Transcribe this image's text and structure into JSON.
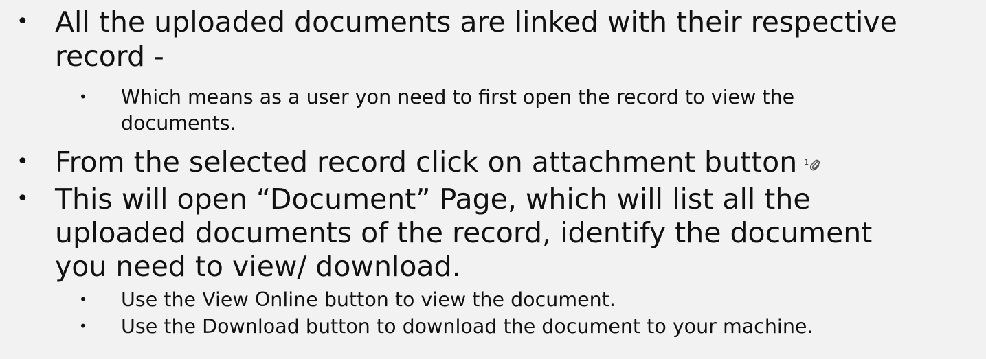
{
  "bullets": [
    {
      "level": 1,
      "lines": [
        "All the uploaded documents are linked with their respective",
        "record -"
      ]
    },
    {
      "level": 2,
      "lines": [
        "Which means as a user yon need to first open the record to view the",
        "documents."
      ]
    },
    {
      "level": 1,
      "lines": [
        "From the selected record click on attachment button"
      ]
    },
    {
      "level": 1,
      "lines": [
        "This will open “Document” Page, which will list all the",
        "uploaded documents of the record, identify the document",
        "you need to view/ download."
      ]
    },
    {
      "level": 2,
      "lines": [
        "Use the View Online button to view the document."
      ]
    },
    {
      "level": 2,
      "lines": [
        "Use the Download button to download the document to your machine."
      ]
    }
  ],
  "attachment_icon": {
    "count": "1",
    "icon": "paperclip-icon"
  },
  "bullet_glyph": "•"
}
